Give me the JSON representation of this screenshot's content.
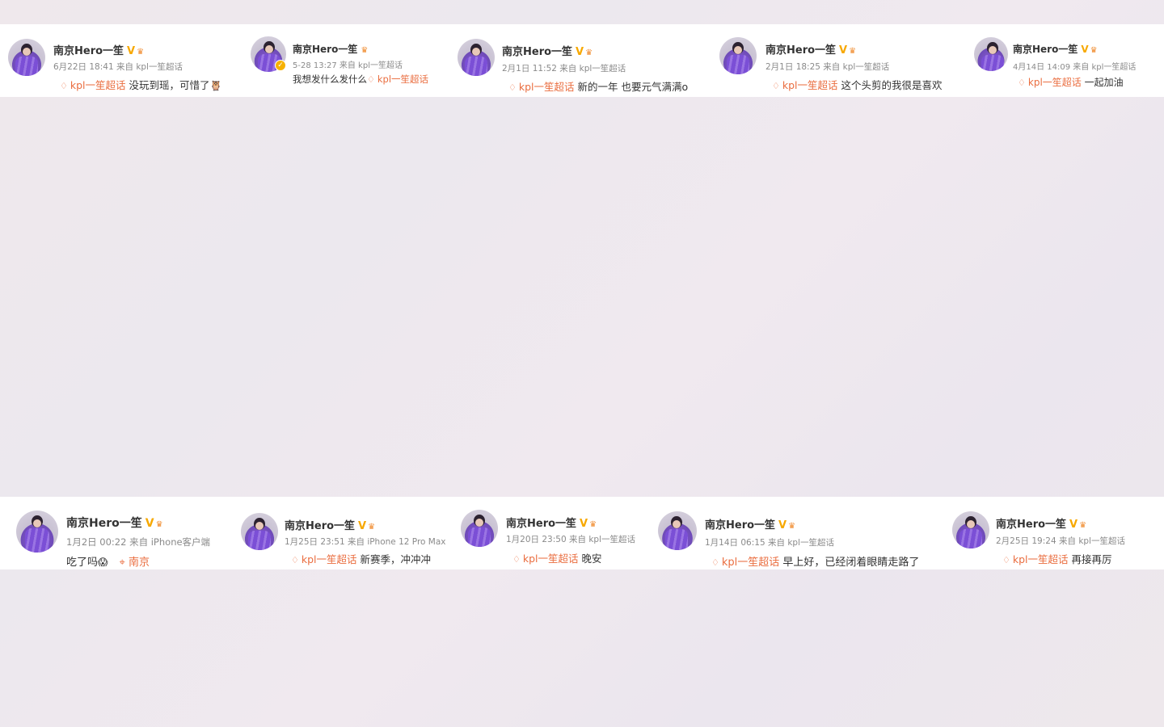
{
  "name": "南京Hero一笙",
  "vip_mark": "V",
  "topic": "kpl一笙超话",
  "icons": {
    "diamond": "diamond-icon",
    "pin": "location-pin-icon",
    "crown": "crown-icon"
  },
  "colors": {
    "topic": "#ea6d3f",
    "vip": "#f7a800",
    "avatar": "#7b4fd6"
  },
  "top_posts": [
    {
      "meta": "6月22日 18:41 来自 kpl一笙超话",
      "text": "没玩到瑶，可惜了",
      "emoji": "🦉"
    },
    {
      "meta": "5-28 13:27 来自 kpl一笙超话",
      "text": "我想发什么发什么"
    },
    {
      "meta": "2月1日 11:52 来自 kpl一笙超话",
      "text": "新的一年 也要元气满满o"
    },
    {
      "meta": "2月1日 18:25 来自 kpl一笙超话",
      "text": "这个头剪的我很是喜欢"
    },
    {
      "meta": "4月14日 14:09 来自 kpl一笙超话",
      "text": "一起加油"
    }
  ],
  "bottom_posts": [
    {
      "meta": "1月2日 00:22 来自 iPhone客户端",
      "text": "吃了吗",
      "emoji": "😱",
      "location": "南京"
    },
    {
      "meta": "1月25日 23:51 来自 iPhone 12 Pro Max",
      "text": "新赛季，冲冲冲"
    },
    {
      "meta": "1月20日 23:50 来自 kpl一笙超话",
      "text": "晚安"
    },
    {
      "meta": "1月14日 06:15 来自 kpl一笙超话",
      "text": "早上好，已经闭着眼睛走路了"
    },
    {
      "meta": "2月25日 19:24 来自 kpl一笙超话",
      "text": "再接再厉"
    }
  ]
}
